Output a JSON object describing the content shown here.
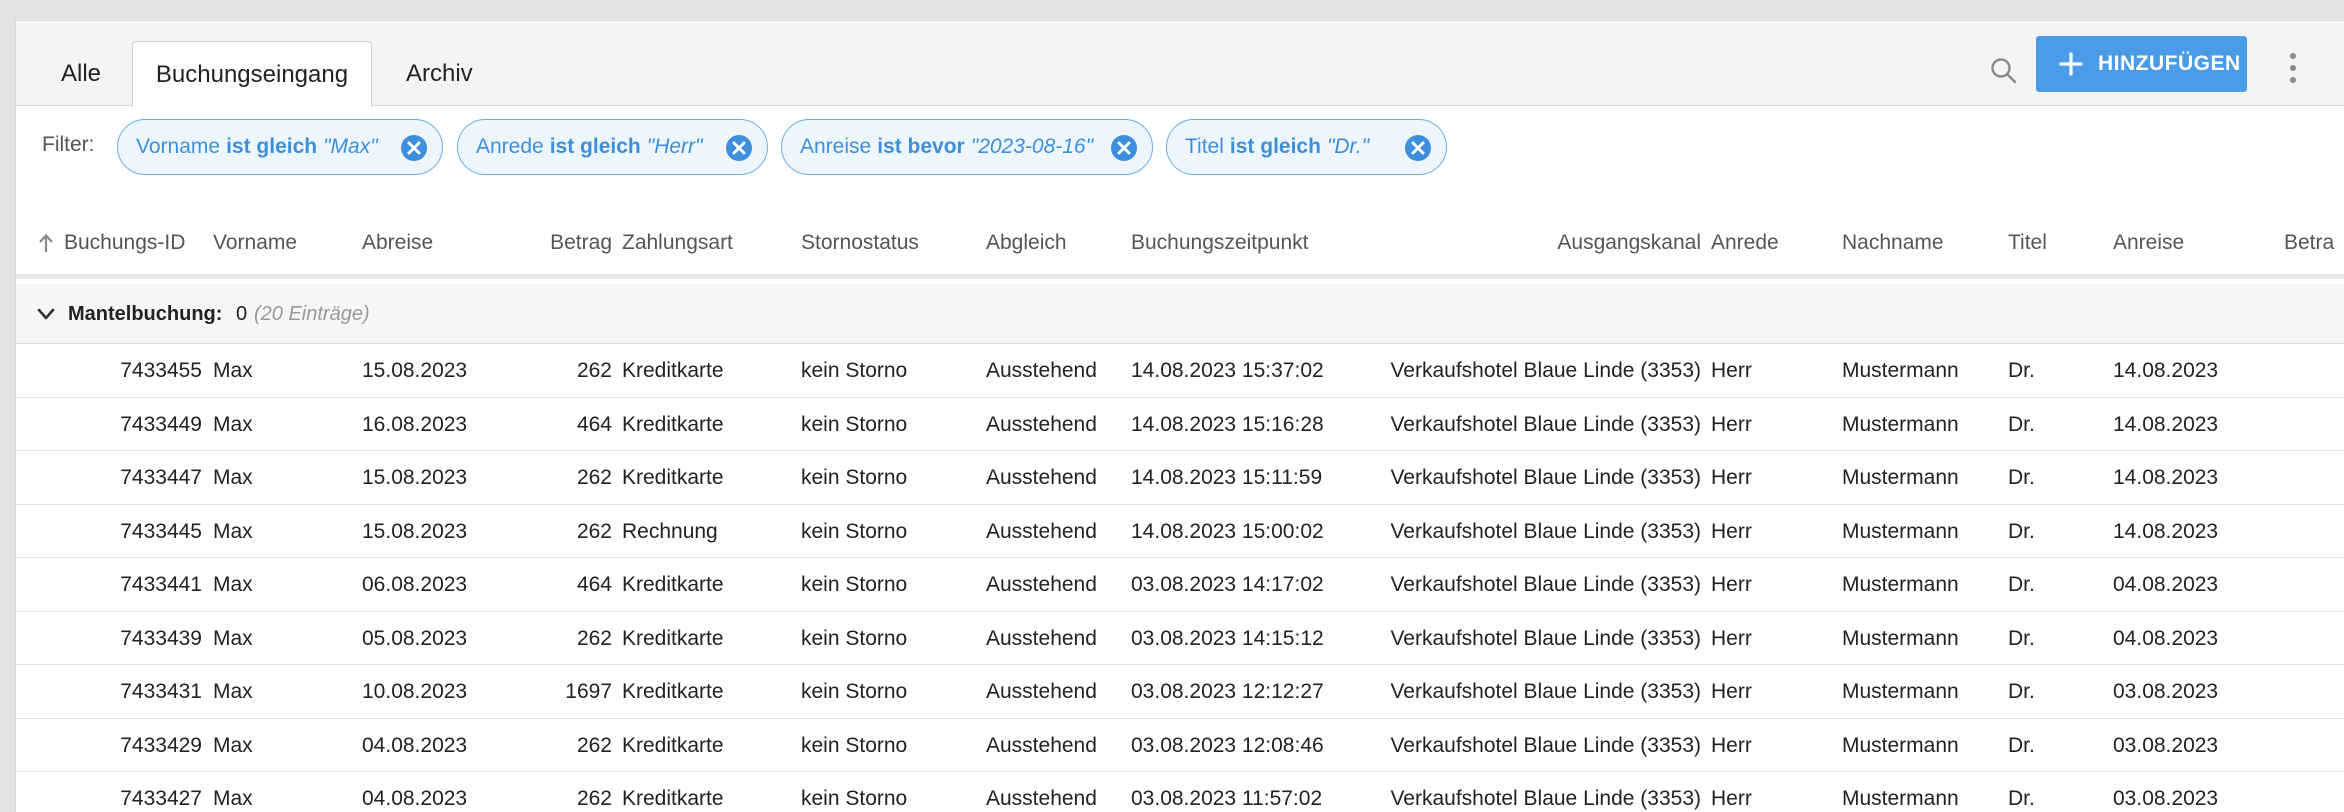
{
  "tabs": [
    {
      "label": "Alle"
    },
    {
      "label": "Buchungseingang"
    },
    {
      "label": "Archiv"
    }
  ],
  "toolbar": {
    "add_label": "HINZUFÜGEN"
  },
  "filter": {
    "label": "Filter:",
    "chips": [
      {
        "field": "Vorname",
        "op": "ist gleich",
        "value": "\"Max\""
      },
      {
        "field": "Anrede",
        "op": "ist gleich",
        "value": "\"Herr\""
      },
      {
        "field": "Anreise",
        "op": "ist bevor",
        "value": "\"2023-08-16\""
      },
      {
        "field": "Titel",
        "op": "ist gleich",
        "value": "\"Dr.\""
      }
    ]
  },
  "columns": [
    "Buchungs-ID",
    "Vorname",
    "Abreise",
    "Betrag",
    "Zahlungsart",
    "Stornostatus",
    "Abgleich",
    "Buchungszeitpunkt",
    "Ausgangskanal",
    "Anrede",
    "Nachname",
    "Titel",
    "Anreise",
    "Betra"
  ],
  "group": {
    "title": "Mantelbuchung:",
    "value": "0",
    "count": "(20 Einträge)"
  },
  "rows": [
    {
      "id": "7433455",
      "fn": "Max",
      "dep": "15.08.2023",
      "amt": "262",
      "pay": "Kreditkarte",
      "stor": "kein Storno",
      "abg": "Ausstehend",
      "ts": "14.08.2023 15:37:02",
      "chan": "Verkaufshotel Blaue Linde (3353)",
      "anr": "Herr",
      "ln": "Mustermann",
      "tit": "Dr.",
      "arr": "14.08.2023"
    },
    {
      "id": "7433449",
      "fn": "Max",
      "dep": "16.08.2023",
      "amt": "464",
      "pay": "Kreditkarte",
      "stor": "kein Storno",
      "abg": "Ausstehend",
      "ts": "14.08.2023 15:16:28",
      "chan": "Verkaufshotel Blaue Linde (3353)",
      "anr": "Herr",
      "ln": "Mustermann",
      "tit": "Dr.",
      "arr": "14.08.2023"
    },
    {
      "id": "7433447",
      "fn": "Max",
      "dep": "15.08.2023",
      "amt": "262",
      "pay": "Kreditkarte",
      "stor": "kein Storno",
      "abg": "Ausstehend",
      "ts": "14.08.2023 15:11:59",
      "chan": "Verkaufshotel Blaue Linde (3353)",
      "anr": "Herr",
      "ln": "Mustermann",
      "tit": "Dr.",
      "arr": "14.08.2023"
    },
    {
      "id": "7433445",
      "fn": "Max",
      "dep": "15.08.2023",
      "amt": "262",
      "pay": "Rechnung",
      "stor": "kein Storno",
      "abg": "Ausstehend",
      "ts": "14.08.2023 15:00:02",
      "chan": "Verkaufshotel Blaue Linde (3353)",
      "anr": "Herr",
      "ln": "Mustermann",
      "tit": "Dr.",
      "arr": "14.08.2023"
    },
    {
      "id": "7433441",
      "fn": "Max",
      "dep": "06.08.2023",
      "amt": "464",
      "pay": "Kreditkarte",
      "stor": "kein Storno",
      "abg": "Ausstehend",
      "ts": "03.08.2023 14:17:02",
      "chan": "Verkaufshotel Blaue Linde (3353)",
      "anr": "Herr",
      "ln": "Mustermann",
      "tit": "Dr.",
      "arr": "04.08.2023"
    },
    {
      "id": "7433439",
      "fn": "Max",
      "dep": "05.08.2023",
      "amt": "262",
      "pay": "Kreditkarte",
      "stor": "kein Storno",
      "abg": "Ausstehend",
      "ts": "03.08.2023 14:15:12",
      "chan": "Verkaufshotel Blaue Linde (3353)",
      "anr": "Herr",
      "ln": "Mustermann",
      "tit": "Dr.",
      "arr": "04.08.2023"
    },
    {
      "id": "7433431",
      "fn": "Max",
      "dep": "10.08.2023",
      "amt": "1697",
      "pay": "Kreditkarte",
      "stor": "kein Storno",
      "abg": "Ausstehend",
      "ts": "03.08.2023 12:12:27",
      "chan": "Verkaufshotel Blaue Linde (3353)",
      "anr": "Herr",
      "ln": "Mustermann",
      "tit": "Dr.",
      "arr": "03.08.2023"
    },
    {
      "id": "7433429",
      "fn": "Max",
      "dep": "04.08.2023",
      "amt": "262",
      "pay": "Kreditkarte",
      "stor": "kein Storno",
      "abg": "Ausstehend",
      "ts": "03.08.2023 12:08:46",
      "chan": "Verkaufshotel Blaue Linde (3353)",
      "anr": "Herr",
      "ln": "Mustermann",
      "tit": "Dr.",
      "arr": "03.08.2023"
    },
    {
      "id": "7433427",
      "fn": "Max",
      "dep": "04.08.2023",
      "amt": "262",
      "pay": "Kreditkarte",
      "stor": "kein Storno",
      "abg": "Ausstehend",
      "ts": "03.08.2023 11:57:02",
      "chan": "Verkaufshotel Blaue Linde (3353)",
      "anr": "Herr",
      "ln": "Mustermann",
      "tit": "Dr.",
      "arr": "03.08.2023"
    }
  ],
  "icons": {
    "search": "search-icon",
    "add": "plus-icon",
    "more": "kebab-menu-icon",
    "chip_remove": "close-circle-icon",
    "sort": "arrow-up-icon",
    "group_toggle": "chevron-down-icon"
  },
  "colors": {
    "accent": "#4a9be8",
    "chip_text": "#3d8fdc",
    "chip_bg": "#eef6fd"
  }
}
